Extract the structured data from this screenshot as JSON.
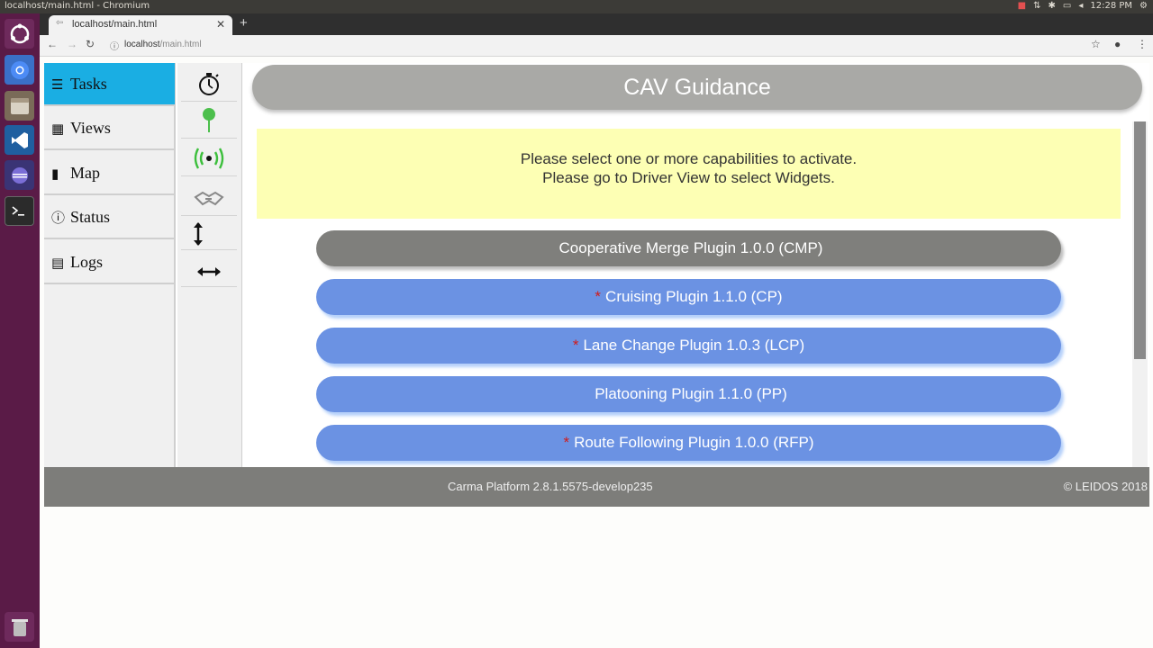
{
  "os": {
    "window_title": "localhost/main.html - Chromium",
    "clock": "12:28 PM"
  },
  "browser": {
    "tab_title": "localhost/main.html",
    "new_tab": "+",
    "url_host": "localhost",
    "url_path": "/main.html"
  },
  "menu": {
    "items": [
      {
        "label": "Tasks",
        "icon": "tasks-icon"
      },
      {
        "label": "Views",
        "icon": "grid-icon"
      },
      {
        "label": "Map",
        "icon": "map-icon"
      },
      {
        "label": "Status",
        "icon": "info-icon"
      },
      {
        "label": "Logs",
        "icon": "file-icon"
      }
    ]
  },
  "status_icons": [
    "stopwatch-icon",
    "pin-icon",
    "radio-signal-icon",
    "handshake-icon",
    "vertical-arrows-icon",
    "horizontal-arrows-icon"
  ],
  "colors": {
    "active_menu": "#1aaee3",
    "plugin_active": "#7f7f7c",
    "plugin_available": "#6b92e3",
    "notice_bg": "#fdffb4",
    "required_marker": "#d01b1b"
  },
  "header": {
    "title": "CAV Guidance"
  },
  "notice": {
    "line1": "Please select one or more capabilities to activate.",
    "line2": "Please go to Driver View to select Widgets."
  },
  "plugins": [
    {
      "label": "Cooperative Merge Plugin 1.0.0 (CMP)",
      "required": ""
    },
    {
      "label": "Cruising Plugin 1.1.0 (CP)",
      "required": "*"
    },
    {
      "label": "Lane Change Plugin 1.0.3 (LCP)",
      "required": "*"
    },
    {
      "label": "Platooning Plugin 1.1.0 (PP)",
      "required": ""
    },
    {
      "label": "Route Following Plugin 1.0.0 (RFP)",
      "required": "*"
    }
  ],
  "footer": {
    "version": "Carma Platform 2.8.1.5575-develop235",
    "copyright": "© LEIDOS 2018"
  }
}
